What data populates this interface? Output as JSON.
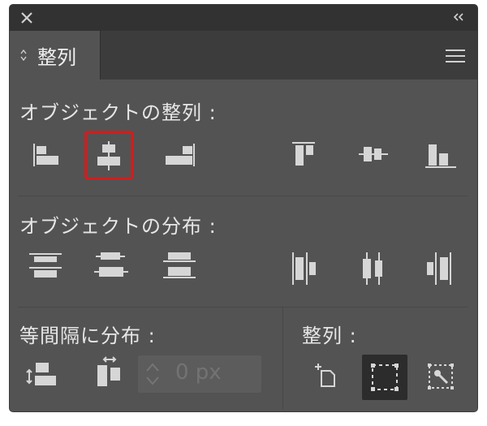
{
  "panel": {
    "tab_label": "整列",
    "icons": {
      "close": "close-icon",
      "collapse": "collapse-double-chevron-icon",
      "menu": "hamburger-menu-icon",
      "tab_arrows": "up-down-arrows-icon"
    }
  },
  "align_objects": {
    "title": "オブジェクトの整列 :",
    "buttons": [
      "align-left-icon",
      "align-horizontal-center-icon",
      "align-right-icon",
      "align-top-icon",
      "align-vertical-center-icon",
      "align-bottom-icon"
    ],
    "selected": "align-horizontal-center-icon"
  },
  "distribute_objects": {
    "title": "オブジェクトの分布 :",
    "buttons": [
      "distribute-top-icon",
      "distribute-vertical-center-icon",
      "distribute-bottom-icon",
      "distribute-left-icon",
      "distribute-horizontal-center-icon",
      "distribute-right-icon"
    ]
  },
  "distribute_spacing": {
    "title": "等間隔に分布 :",
    "buttons": [
      "distribute-vertical-spacing-icon",
      "distribute-horizontal-spacing-icon"
    ],
    "spacing_value": "0 px"
  },
  "align_to": {
    "title": "整列 :",
    "buttons": [
      "align-to-artboard-icon",
      "align-to-selection-icon",
      "align-to-key-object-icon"
    ],
    "selected": "align-to-selection-icon"
  },
  "colors": {
    "panel_bg": "#535353",
    "selection_red": "#d21d1d",
    "icon": "#d6d6d6"
  }
}
